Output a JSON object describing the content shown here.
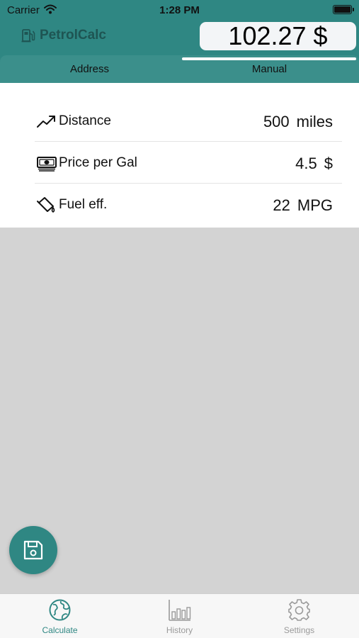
{
  "status_bar": {
    "carrier": "Carrier",
    "time": "1:28 PM"
  },
  "app": {
    "title": "PetrolCalc",
    "total": "102.27 $",
    "logo_icon": "fuel-pump-icon"
  },
  "tabs": [
    {
      "label": "Address",
      "selected": false
    },
    {
      "label": "Manual",
      "selected": true
    }
  ],
  "form": {
    "distance": {
      "label": "Distance",
      "value": "500",
      "unit": "miles",
      "icon": "trending-up-icon"
    },
    "price": {
      "label": "Price per Gal",
      "value": "4.5",
      "unit": "$",
      "icon": "money-icon"
    },
    "efficiency": {
      "label": "Fuel eff.",
      "value": "22",
      "unit": "MPG",
      "icon": "fuel-can-icon"
    }
  },
  "fab": {
    "icon": "save-icon"
  },
  "tabbar": [
    {
      "label": "Calculate",
      "icon": "globe-icon",
      "active": true
    },
    {
      "label": "History",
      "icon": "bar-chart-icon",
      "active": false
    },
    {
      "label": "Settings",
      "icon": "gear-icon",
      "active": false
    }
  ],
  "colors": {
    "accent": "#2f8783",
    "tab_strip": "#3b8f8b",
    "active_tab": "#2f8783",
    "inactive_tab": "#9a9a9a",
    "background": "#d3d3d3"
  }
}
